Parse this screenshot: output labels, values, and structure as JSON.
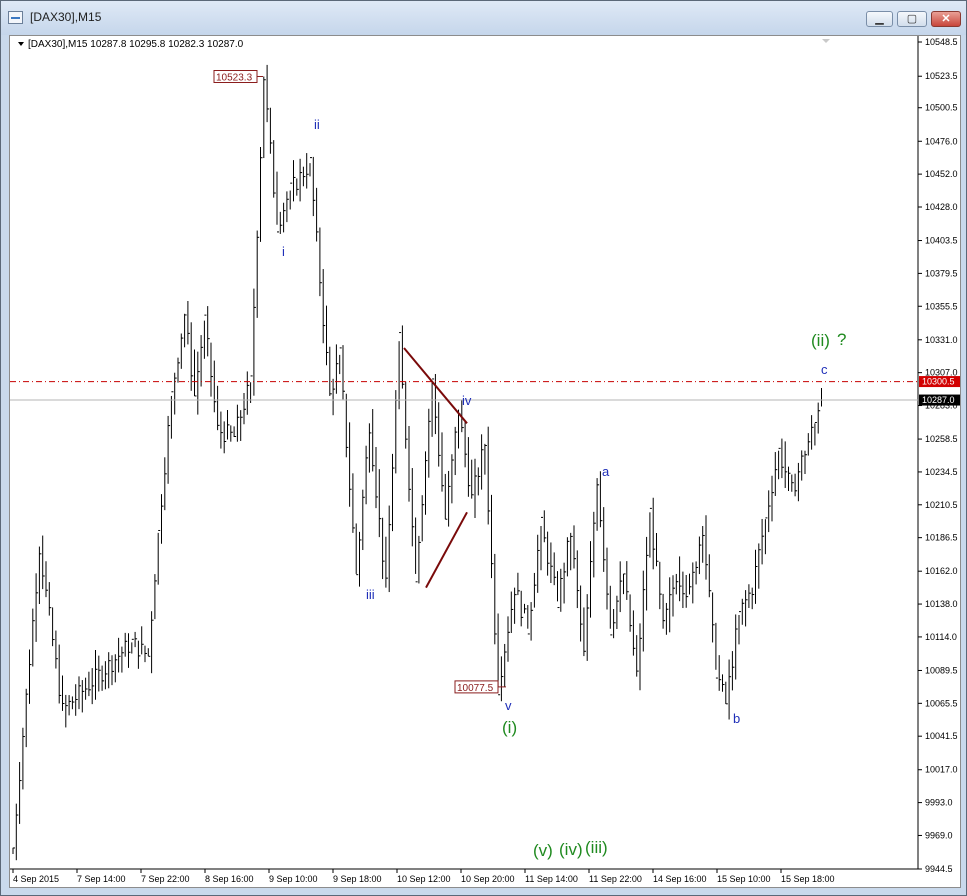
{
  "window": {
    "title": "[DAX30],M15",
    "minimize_glyph": "▁",
    "maximize_glyph": "▢",
    "close_glyph": "✕"
  },
  "chart_info": "[DAX30],M15  10287.8 10295.8 10282.3 10287.0",
  "price_ticks": [
    "10548.5",
    "10523.5",
    "10500.5",
    "10476.0",
    "10452.0",
    "10428.0",
    "10403.5",
    "10379.5",
    "10355.5",
    "10331.0",
    "10307.0",
    "10283.0",
    "10258.5",
    "10234.5",
    "10210.5",
    "10186.5",
    "10162.0",
    "10138.0",
    "10114.0",
    "10089.5",
    "10065.5",
    "10041.5",
    "10017.0",
    "9993.0",
    "9969.0",
    "9944.5"
  ],
  "time_ticks": [
    "4 Sep 2015",
    "7 Sep 14:00",
    "7 Sep 22:00",
    "8 Sep 16:00",
    "9 Sep 10:00",
    "9 Sep 18:00",
    "10 Sep 12:00",
    "10 Sep 20:00",
    "11 Sep 14:00",
    "11 Sep 22:00",
    "14 Sep 16:00",
    "15 Sep 10:00",
    "15 Sep 18:00"
  ],
  "level_alert": "10300.5",
  "level_current": "10287.0",
  "price_labels": {
    "high": "10523.3",
    "low": "10077.5"
  },
  "wave_labels": {
    "i": "i",
    "ii": "ii",
    "iii": "iii",
    "iv": "iv",
    "v": "v",
    "one": "(i)",
    "a": "a",
    "b": "b",
    "c": "c",
    "two": "(ii)",
    "question": "?",
    "v5": "(v)",
    "iv4": "(iv)",
    "iii3": "(iii)"
  },
  "colors": {
    "alert_line": "#c80000",
    "wave_blue": "#1f2fb8",
    "wave_green": "#1f8a1f",
    "triangle": "#7a0a0a",
    "bars": "#000000"
  },
  "chart_data": {
    "type": "bar",
    "symbol": "DAX30",
    "timeframe": "M15",
    "ohlc": {
      "open": 10287.8,
      "high": 10295.8,
      "low": 10282.3,
      "close": 10287.0
    },
    "ylim": [
      9944.5,
      10548.5
    ],
    "x": [
      "4 Sep 2015",
      "7 Sep 14:00",
      "7 Sep 22:00",
      "8 Sep 16:00",
      "9 Sep 10:00",
      "9 Sep 18:00",
      "10 Sep 12:00",
      "10 Sep 20:00",
      "11 Sep 14:00",
      "11 Sep 22:00",
      "14 Sep 16:00",
      "15 Sep 10:00",
      "15 Sep 18:00"
    ],
    "swing_path": [
      {
        "i": 0,
        "p": 9960
      },
      {
        "i": 8,
        "p": 10180
      },
      {
        "i": 15,
        "p": 10060
      },
      {
        "i": 36,
        "p": 10110
      },
      {
        "i": 41,
        "p": 10100
      },
      {
        "i": 44,
        "p": 10190
      },
      {
        "i": 48,
        "p": 10290
      },
      {
        "i": 52,
        "p": 10350
      },
      {
        "i": 55,
        "p": 10290
      },
      {
        "i": 58,
        "p": 10345
      },
      {
        "i": 62,
        "p": 10265
      },
      {
        "i": 67,
        "p": 10260
      },
      {
        "i": 72,
        "p": 10300
      },
      {
        "i": 76,
        "p": 10523.3
      },
      {
        "i": 80,
        "p": 10415
      },
      {
        "i": 84,
        "p": 10440
      },
      {
        "i": 90,
        "p": 10460
      },
      {
        "i": 96,
        "p": 10290
      },
      {
        "i": 99,
        "p": 10320
      },
      {
        "i": 104,
        "p": 10160
      },
      {
        "i": 108,
        "p": 10270
      },
      {
        "i": 113,
        "p": 10150
      },
      {
        "i": 117,
        "p": 10330
      },
      {
        "i": 122,
        "p": 10160
      },
      {
        "i": 127,
        "p": 10300
      },
      {
        "i": 131,
        "p": 10200
      },
      {
        "i": 135,
        "p": 10280
      },
      {
        "i": 139,
        "p": 10215
      },
      {
        "i": 143,
        "p": 10255
      },
      {
        "i": 147,
        "p": 10077.5
      },
      {
        "i": 152,
        "p": 10150
      },
      {
        "i": 156,
        "p": 10120
      },
      {
        "i": 160,
        "p": 10195
      },
      {
        "i": 165,
        "p": 10140
      },
      {
        "i": 169,
        "p": 10190
      },
      {
        "i": 173,
        "p": 10100
      },
      {
        "i": 177,
        "p": 10230
      },
      {
        "i": 181,
        "p": 10120
      },
      {
        "i": 185,
        "p": 10160
      },
      {
        "i": 189,
        "p": 10085
      },
      {
        "i": 193,
        "p": 10205
      },
      {
        "i": 197,
        "p": 10120
      },
      {
        "i": 201,
        "p": 10160
      },
      {
        "i": 205,
        "p": 10145
      },
      {
        "i": 209,
        "p": 10195
      },
      {
        "i": 213,
        "p": 10090
      },
      {
        "i": 216,
        "p": 10065
      },
      {
        "i": 220,
        "p": 10130
      },
      {
        "i": 224,
        "p": 10150
      },
      {
        "i": 228,
        "p": 10200
      },
      {
        "i": 232,
        "p": 10250
      },
      {
        "i": 236,
        "p": 10220
      },
      {
        "i": 240,
        "p": 10250
      },
      {
        "i": 243,
        "p": 10270
      },
      {
        "i": 245,
        "p": 10295.8
      }
    ],
    "levels": [
      {
        "name": "alert",
        "price": 10300.5
      },
      {
        "name": "current",
        "price": 10287.0
      }
    ],
    "annotations": [
      {
        "text": "10523.3",
        "price": 10523.3
      },
      {
        "text": "10077.5",
        "price": 10077.5
      },
      {
        "text": "i",
        "price": 10403
      },
      {
        "text": "ii",
        "price": 10515
      },
      {
        "text": "iii",
        "price": 10150
      },
      {
        "text": "iv",
        "price": 10290
      },
      {
        "text": "v",
        "price": 10067
      },
      {
        "text": "(i)",
        "price": 10045
      },
      {
        "text": "a",
        "price": 10242
      },
      {
        "text": "b",
        "price": 10057
      },
      {
        "text": "c",
        "price": 10310
      },
      {
        "text": "(ii) ?",
        "price": 10335
      },
      {
        "text": "(v) (iv)(iii)",
        "price": 9957
      }
    ],
    "triangle": [
      {
        "time": "10 Sep 00:00",
        "price": 10325
      },
      {
        "time": "10 Sep 16:00",
        "price": 10270
      },
      {
        "time": "10 Sep 16:00",
        "price": 10205
      },
      {
        "time": "10 Sep 11:00",
        "price": 10150
      }
    ],
    "grid": false,
    "legend": "none"
  }
}
